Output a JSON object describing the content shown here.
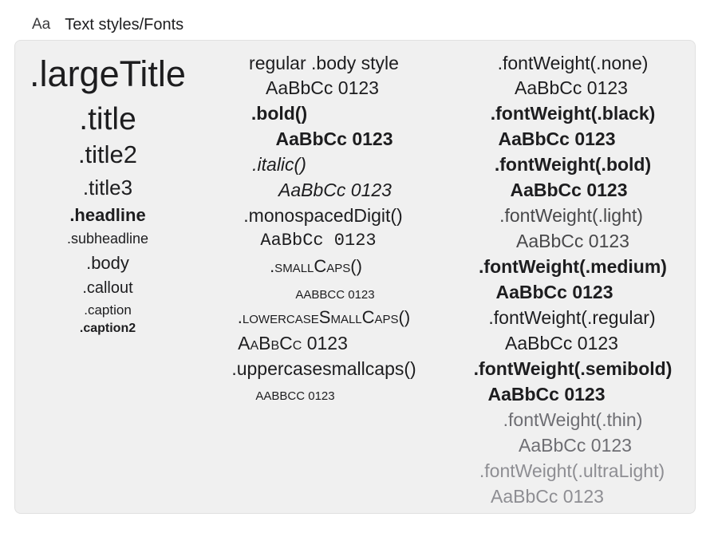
{
  "header": {
    "icon": "Aa",
    "title": "Text styles/Fonts"
  },
  "col1": [
    ".largeTitle",
    ".title",
    ".title2",
    ".title3",
    ".headline",
    ".subheadline",
    ".body",
    ".callout",
    ".caption",
    ".caption2"
  ],
  "col2": [
    "regular .body style",
    "AaBbCc 0123",
    ".bold()",
    "AaBbCc 0123",
    ".italic()",
    "AaBbCc 0123",
    ".monospacedDigit()",
    "AaBbCc 0123",
    ".smallCaps()",
    "AaBbCc 0123",
    ".lowercaseSmallCaps()",
    "AaBbCc 0123",
    ".uppercasesmallcaps()",
    "AaBbCc 0123"
  ],
  "col3": [
    ".fontWeight(.none)",
    "AaBbCc 0123",
    ".fontWeight(.black)",
    "AaBbCc 0123",
    ".fontWeight(.bold)",
    "AaBbCc 0123",
    ".fontWeight(.light)",
    "AaBbCc 0123",
    ".fontWeight(.medium)",
    "AaBbCc 0123",
    ".fontWeight(.regular)",
    "AaBbCc 0123",
    ".fontWeight(.semibold)",
    "AaBbCc 0123",
    ".fontWeight(.thin)",
    "AaBbCc 0123",
    ".fontWeight(.ultraLight)",
    "AaBbCc 0123"
  ]
}
